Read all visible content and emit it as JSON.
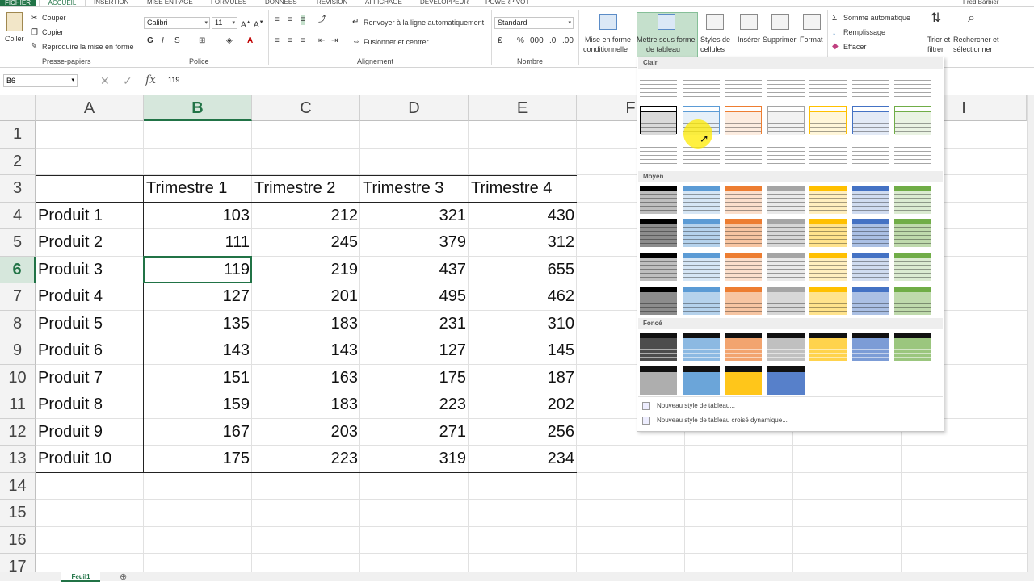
{
  "tabs": {
    "file": "FICHIER",
    "home": "ACCUEIL",
    "insert": "INSERTION",
    "layout": "MISE EN PAGE",
    "formulas": "FORMULES",
    "data": "DONNÉES",
    "review": "RÉVISION",
    "view": "AFFICHAGE",
    "developer": "DÉVELOPPEUR",
    "powerpivot": "POWERPIVOT",
    "user": "Fred Barbier"
  },
  "ribbon": {
    "clipboard": {
      "paste": "Coller",
      "cut": "Couper",
      "copy": "Copier",
      "format_painter": "Reproduire la mise en forme",
      "label": "Presse-papiers"
    },
    "font": {
      "name": "Calibri",
      "size": "11",
      "bold": "G",
      "italic": "I",
      "underline": "S",
      "label": "Police"
    },
    "alignment": {
      "wrap": "Renvoyer à la ligne automatiquement",
      "merge": "Fusionner et centrer",
      "label": "Alignement"
    },
    "number": {
      "format": "Standard",
      "label": "Nombre"
    },
    "styles": {
      "conditional_l1": "Mise en forme",
      "conditional_l2": "conditionnelle",
      "table_l1": "Mettre sous forme",
      "table_l2": "de tableau",
      "cell_l1": "Styles de",
      "cell_l2": "cellules"
    },
    "cells": {
      "insert": "Insérer",
      "delete": "Supprimer",
      "format": "Format"
    },
    "editing": {
      "autosum": "Somme automatique",
      "fill": "Remplissage",
      "clear": "Effacer",
      "sort_l1": "Trier et",
      "sort_l2": "filtrer",
      "find_l1": "Rechercher et",
      "find_l2": "sélectionner"
    }
  },
  "formula_bar": {
    "name_box": "B6",
    "fx": "fx",
    "value": "119"
  },
  "columns": [
    "A",
    "B",
    "C",
    "D",
    "E",
    "F",
    "",
    "",
    "I"
  ],
  "rows": [
    "1",
    "2",
    "3",
    "4",
    "5",
    "6",
    "7",
    "8",
    "9",
    "10",
    "11",
    "12",
    "13",
    "14",
    "15",
    "16",
    "17"
  ],
  "table": {
    "headers": [
      "Trimestre 1",
      "Trimestre 2",
      "Trimestre 3",
      "Trimestre 4"
    ],
    "data": [
      [
        "Produit 1",
        "103",
        "212",
        "321",
        "430"
      ],
      [
        "Produit 2",
        "111",
        "245",
        "379",
        "312"
      ],
      [
        "Produit 3",
        "119",
        "219",
        "437",
        "655"
      ],
      [
        "Produit 4",
        "127",
        "201",
        "495",
        "462"
      ],
      [
        "Produit 5",
        "135",
        "183",
        "231",
        "310"
      ],
      [
        "Produit 6",
        "143",
        "143",
        "127",
        "145"
      ],
      [
        "Produit 7",
        "151",
        "163",
        "175",
        "187"
      ],
      [
        "Produit 8",
        "159",
        "183",
        "223",
        "202"
      ],
      [
        "Produit 9",
        "167",
        "203",
        "271",
        "256"
      ],
      [
        "Produit 10",
        "175",
        "223",
        "319",
        "234"
      ]
    ]
  },
  "gallery": {
    "light": "Clair",
    "medium": "Moyen",
    "dark": "Foncé",
    "new_table_style": "Nouveau style de tableau...",
    "new_pivot_style": "Nouveau style de tableau croisé dynamique...",
    "palette": [
      "#000000",
      "#5b9bd5",
      "#ed7d31",
      "#a5a5a5",
      "#ffc000",
      "#4472c4",
      "#70ad47"
    ]
  },
  "sheet": {
    "name": "Feuil1"
  },
  "colors": {
    "accent": "#217346",
    "selection": "#d6e7dc"
  }
}
